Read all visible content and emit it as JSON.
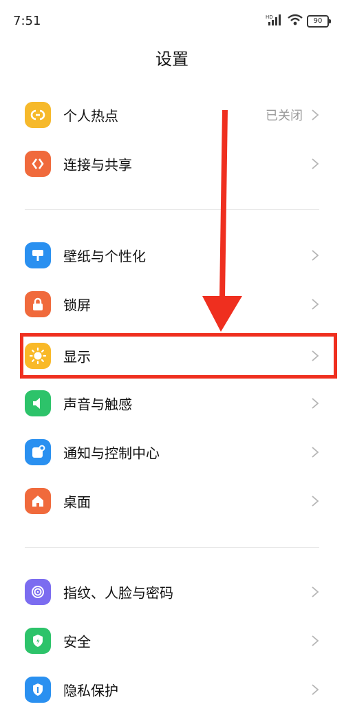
{
  "status": {
    "time": "7:51",
    "hd": "HD",
    "battery": "90"
  },
  "header": {
    "title": "设置"
  },
  "groups": [
    {
      "items": [
        {
          "label": "个人热点",
          "value": "已关闭",
          "icon": "hotspot-icon",
          "color": "#f6b92b"
        },
        {
          "label": "连接与共享",
          "value": "",
          "icon": "connection-share-icon",
          "color": "#f06a3c"
        }
      ]
    },
    {
      "items": [
        {
          "label": "壁纸与个性化",
          "value": "",
          "icon": "wallpaper-icon",
          "color": "#2a90f0"
        },
        {
          "label": "锁屏",
          "value": "",
          "icon": "lock-icon",
          "color": "#f06a3c"
        },
        {
          "label": "显示",
          "value": "",
          "icon": "sun-icon",
          "color": "#f9b928"
        },
        {
          "label": "声音与触感",
          "value": "",
          "icon": "speaker-icon",
          "color": "#2dc36a"
        },
        {
          "label": "通知与控制中心",
          "value": "",
          "icon": "notification-icon",
          "color": "#2a90f0"
        },
        {
          "label": "桌面",
          "value": "",
          "icon": "home-icon",
          "color": "#f06a3c"
        }
      ]
    },
    {
      "items": [
        {
          "label": "指纹、人脸与密码",
          "value": "",
          "icon": "fingerprint-icon",
          "color": "#7b6cf0"
        },
        {
          "label": "安全",
          "value": "",
          "icon": "shield-icon",
          "color": "#2dc36a"
        },
        {
          "label": "隐私保护",
          "value": "",
          "icon": "privacy-icon",
          "color": "#2a90f0"
        }
      ]
    }
  ],
  "annotation": {
    "highlight_color": "#ef2f1f"
  }
}
